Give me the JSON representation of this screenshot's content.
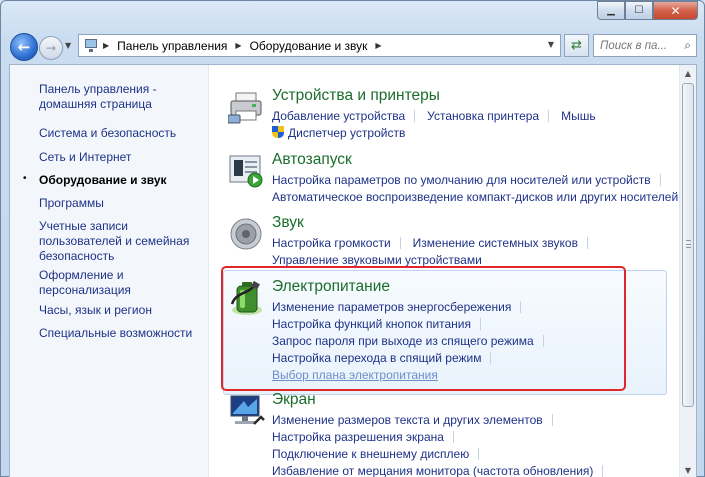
{
  "window": {
    "minimize_icon": "minimize-icon",
    "maximize_icon": "maximize-icon",
    "close_icon": "close-icon"
  },
  "nav": {
    "breadcrumbs": [
      "Панель управления",
      "Оборудование и звук"
    ],
    "search_placeholder": "Поиск в па..."
  },
  "sidebar": {
    "items": [
      {
        "label": "Панель управления - домашняя страница",
        "active": false
      },
      {
        "label": "Система и безопасность",
        "active": false
      },
      {
        "label": "Сеть и Интернет",
        "active": false
      },
      {
        "label": "Оборудование и звук",
        "active": true
      },
      {
        "label": "Программы",
        "active": false
      },
      {
        "label": "Учетные записи пользователей и семейная безопасность",
        "active": false
      },
      {
        "label": "Оформление и персонализация",
        "active": false
      },
      {
        "label": "Часы, язык и регион",
        "active": false
      },
      {
        "label": "Специальные возможности",
        "active": false
      }
    ],
    "bullet": "•"
  },
  "categories": [
    {
      "title": "Устройства и принтеры",
      "icon": "printer-icon",
      "lines": [
        [
          "Добавление устройства",
          "Установка принтера",
          "Мышь"
        ],
        [
          "Диспетчер устройств"
        ]
      ]
    },
    {
      "title": "Автозапуск",
      "icon": "autoplay-icon",
      "lines": [
        [
          "Настройка параметров по умолчанию для носителей или устройств"
        ],
        [
          "Автоматическое воспроизведение компакт-дисков или других носителей"
        ]
      ]
    },
    {
      "title": "Звук",
      "icon": "speaker-icon",
      "lines": [
        [
          "Настройка громкости",
          "Изменение системных звуков"
        ],
        [
          "Управление звуковыми устройствами"
        ]
      ]
    },
    {
      "title": "Электропитание",
      "icon": "battery-icon",
      "lines": [
        [
          "Изменение параметров энергосбережения"
        ],
        [
          "Настройка функций кнопок питания"
        ],
        [
          "Запрос пароля при выходе из спящего режима"
        ],
        [
          "Настройка перехода в спящий режим"
        ],
        [
          "Выбор плана электропитания"
        ]
      ]
    },
    {
      "title": "Экран",
      "icon": "display-icon",
      "lines": [
        [
          "Изменение размеров текста и других элементов"
        ],
        [
          "Настройка разрешения экрана"
        ],
        [
          "Подключение к внешнему дисплею"
        ],
        [
          "Избавление от мерцания монитора (частота обновления)"
        ]
      ]
    }
  ],
  "colors": {
    "highlight": "#e0272b",
    "title_green": "#1b6d2c",
    "link_blue": "#1e3287"
  }
}
